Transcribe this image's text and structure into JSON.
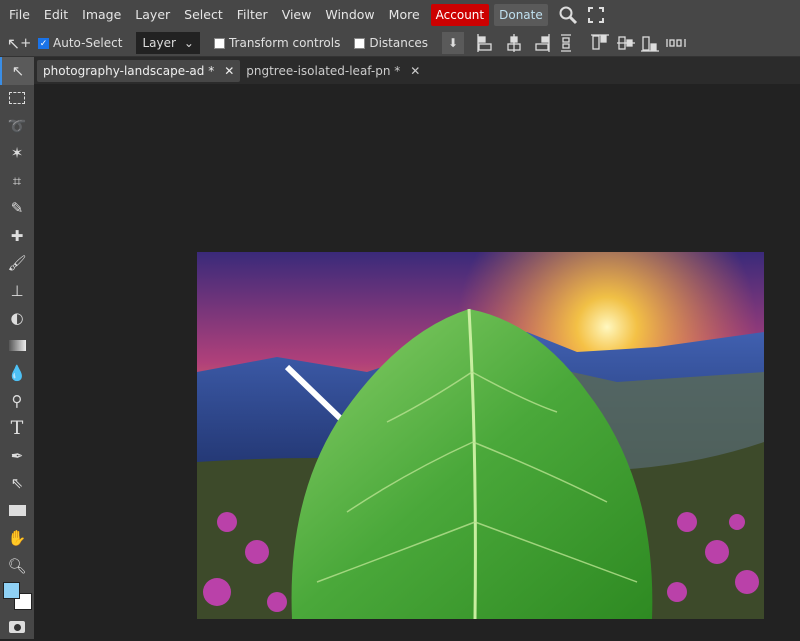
{
  "menu": {
    "items": [
      "File",
      "Edit",
      "Image",
      "Layer",
      "Select",
      "Filter",
      "View",
      "Window",
      "More"
    ],
    "account": "Account",
    "donate": "Donate",
    "colors": {
      "account": "#cc0000"
    }
  },
  "options": {
    "auto_select_label": "Auto-Select",
    "auto_select_checked": true,
    "layer_select": "Layer",
    "transform_label": "Transform controls",
    "transform_checked": false,
    "distances_label": "Distances",
    "distances_checked": false
  },
  "tabs": [
    {
      "label": "photography-landscape-ad",
      "modified": "*",
      "active": true
    },
    {
      "label": "pngtree-isolated-leaf-pn",
      "modified": "*",
      "active": false
    }
  ],
  "tools": [
    "move-tool",
    "marquee-tool",
    "lasso-tool",
    "magic-wand-tool",
    "crop-tool",
    "eyedropper-tool",
    "healing-tool",
    "brush-tool",
    "stamp-tool",
    "eraser-tool",
    "gradient-tool",
    "blur-tool",
    "dodge-tool",
    "type-tool",
    "pen-tool",
    "path-select-tool",
    "shape-tool",
    "hand-tool",
    "zoom-tool"
  ],
  "colors": {
    "foreground": "#8fd1f5",
    "background": "#ffffff"
  }
}
